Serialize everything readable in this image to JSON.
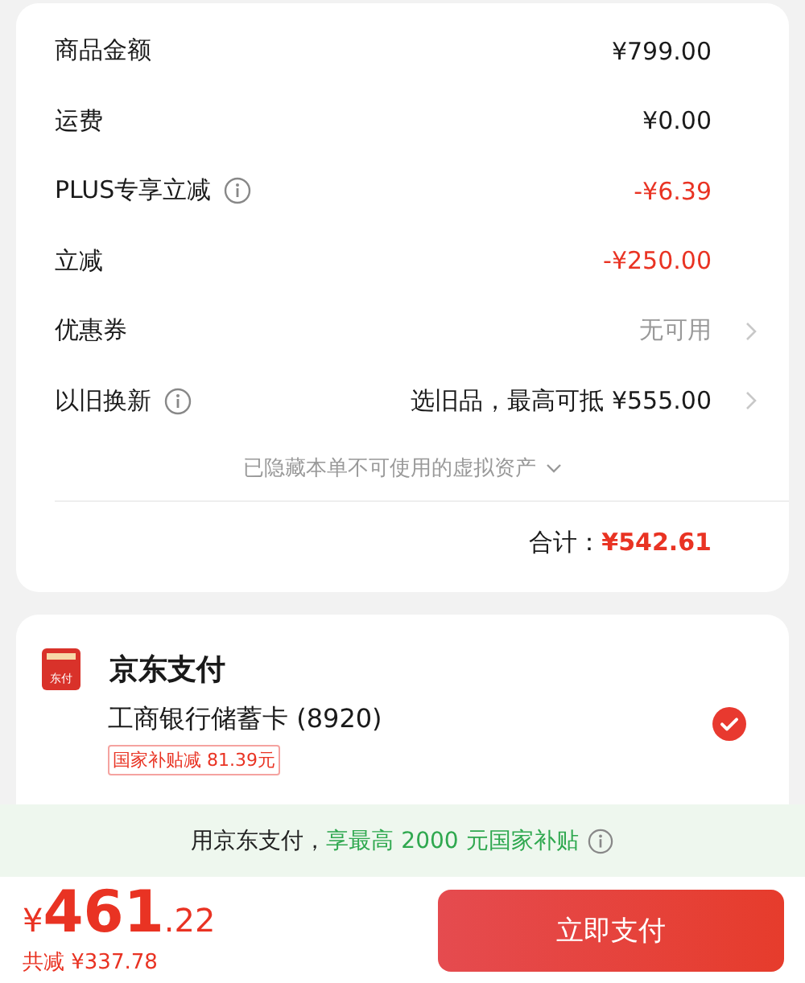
{
  "summary": {
    "rows": [
      {
        "label": "商品金额",
        "value": "¥799.00",
        "kind": "default",
        "info": false,
        "chevron": false
      },
      {
        "label": "运费",
        "value": "¥0.00",
        "kind": "default",
        "info": false,
        "chevron": false
      },
      {
        "label": "PLUS专享立减",
        "value": "-¥6.39",
        "kind": "discount",
        "info": true,
        "chevron": false
      },
      {
        "label": "立减",
        "value": "-¥250.00",
        "kind": "discount",
        "info": false,
        "chevron": false
      },
      {
        "label": "优惠券",
        "value": "无可用",
        "kind": "muted",
        "info": false,
        "chevron": true
      },
      {
        "label": "以旧换新",
        "value": "选旧品，最高可抵 ¥555.00",
        "kind": "default",
        "info": true,
        "chevron": true
      }
    ],
    "hidden_note": "已隐藏本单不可使用的虚拟资产",
    "hidden_expanded": false,
    "total_label": "合计：",
    "total_value": "¥542.61"
  },
  "payment": {
    "title": "京东支付",
    "logo_text": "东付",
    "methods": [
      {
        "name": "工商银行储蓄卡 (8920)",
        "tag": "国家补贴减 81.39元",
        "selected": true
      }
    ]
  },
  "banner": {
    "text": "用京东支付，",
    "highlight": "享最高 2000 元国家补贴"
  },
  "footer": {
    "currency": "¥",
    "amount_integer": "461",
    "amount_decimal": ".22",
    "savings": "共减 ¥337.78",
    "button": "立即支付"
  }
}
